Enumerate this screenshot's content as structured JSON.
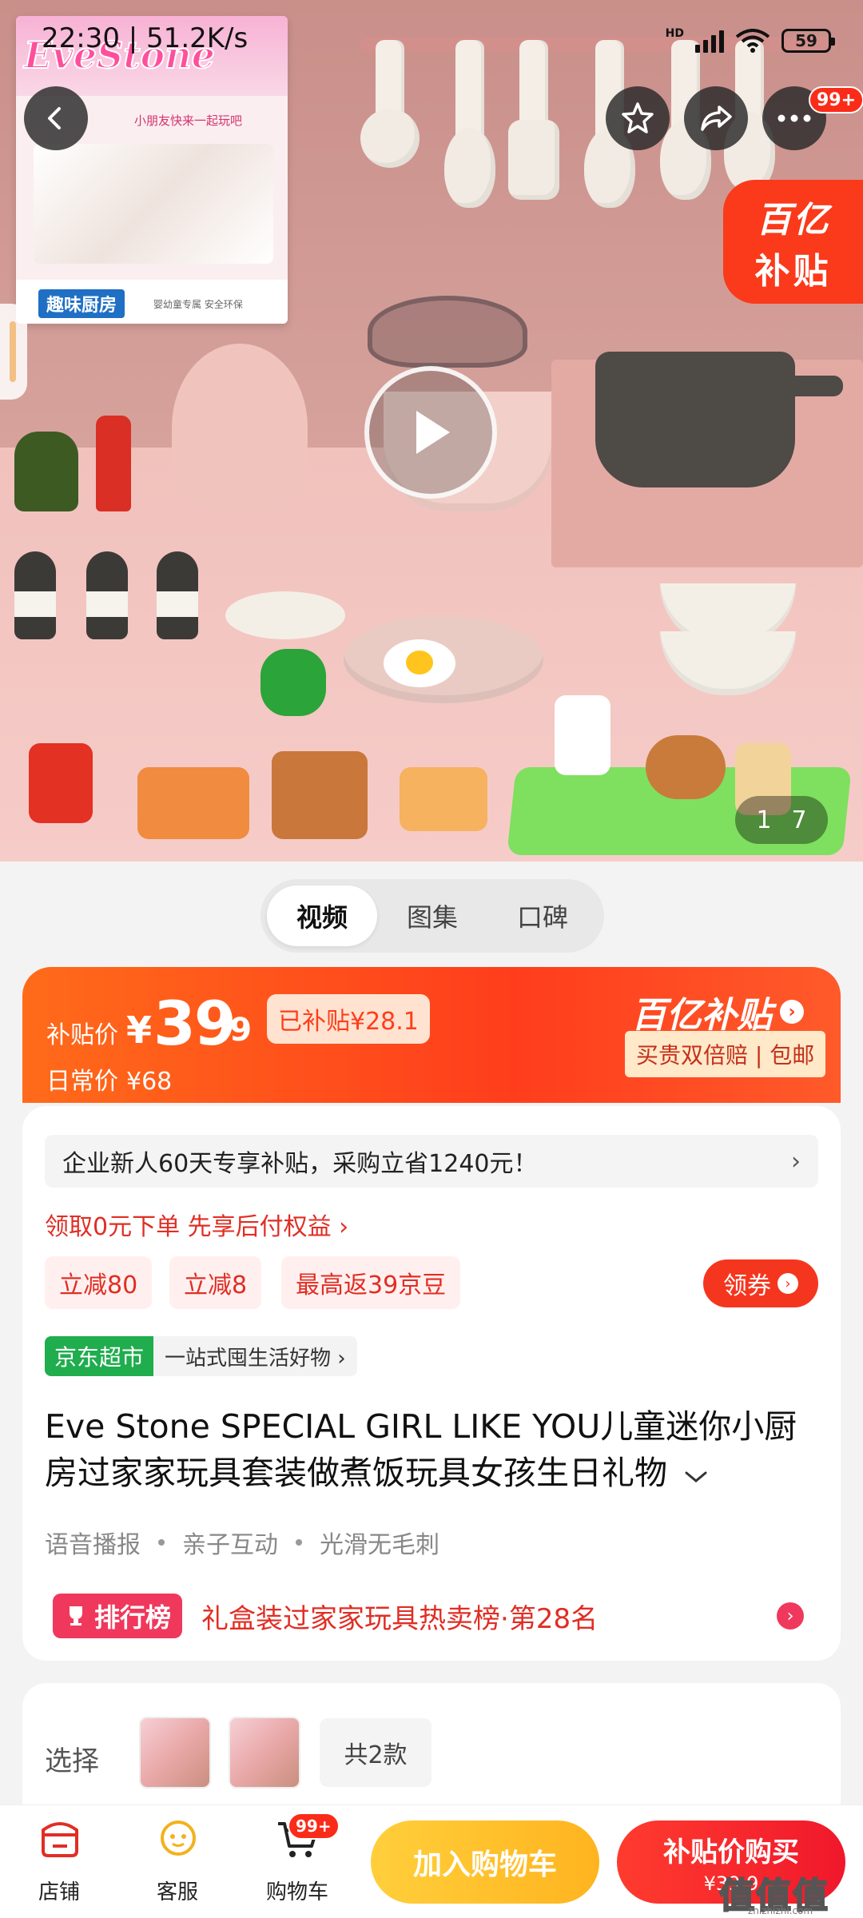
{
  "status_bar": {
    "time": "22:30 | 51.2K/s",
    "hd": "HD",
    "battery": "59"
  },
  "hero": {
    "box_brand": "EveStone",
    "box_slogan": "小朋友快来一起玩吧",
    "box_name": "趣味厨房",
    "box_note": "婴幼童专属  安全环保",
    "image_index": "1",
    "image_total": "7",
    "cart_badge": "99+",
    "subsidy_sticker_line1": "百亿",
    "subsidy_sticker_line2": "补贴"
  },
  "media_tabs": [
    {
      "label": "视频",
      "active": true
    },
    {
      "label": "图集",
      "active": false
    },
    {
      "label": "口碑",
      "active": false
    }
  ],
  "price": {
    "label": "补贴价",
    "currency": "¥",
    "integer": "39",
    "decimal": ".9",
    "subsidized_tag": "已补贴¥28.1",
    "daily_label": "日常价",
    "daily_value": "¥68",
    "program_name": "百亿补贴",
    "program_tag": "买贵双倍赔 | 包邮"
  },
  "promotions": {
    "newbie_text": "企业新人60天专享补贴，采购立省1240元！",
    "credit_text": "领取0元下单 先享后付权益 ›",
    "coupons": [
      "立减80",
      "立减8",
      "最高返39京豆"
    ],
    "claim_label": "领券"
  },
  "market": {
    "tag": "京东超市",
    "text": "一站式囤生活好物 ›"
  },
  "product": {
    "title": "Eve Stone SPECIAL GIRL LIKE YOU儿童迷你小厨房过家家玩具套装做煮饭玩具女孩生日礼物",
    "features": [
      "语音播报",
      "亲子互动",
      "光滑无毛刺"
    ]
  },
  "rank": {
    "badge": "排行榜",
    "text": "礼盒装过家家玩具热卖榜·第28名"
  },
  "select": {
    "label": "选择",
    "count_label": "共2款"
  },
  "bottom_bar": {
    "store_label": "店铺",
    "service_label": "客服",
    "cart_label": "购物车",
    "cart_badge": "99+",
    "add_to_cart": "加入购物车",
    "buy_label": "补贴价购买",
    "buy_price": "¥39.9"
  },
  "watermark": {
    "main": "值值值",
    "sub": "zhizhizhi.com"
  },
  "colors": {
    "brand_red": "#fa2c19",
    "subsidy_orange": "#ff5a1a",
    "market_green": "#1fad4e",
    "cart_yellow": "#ffb41f"
  },
  "icons": [
    "back-icon",
    "star-icon",
    "share-icon",
    "more-icon",
    "play-icon",
    "store-icon",
    "service-icon",
    "cart-icon"
  ]
}
